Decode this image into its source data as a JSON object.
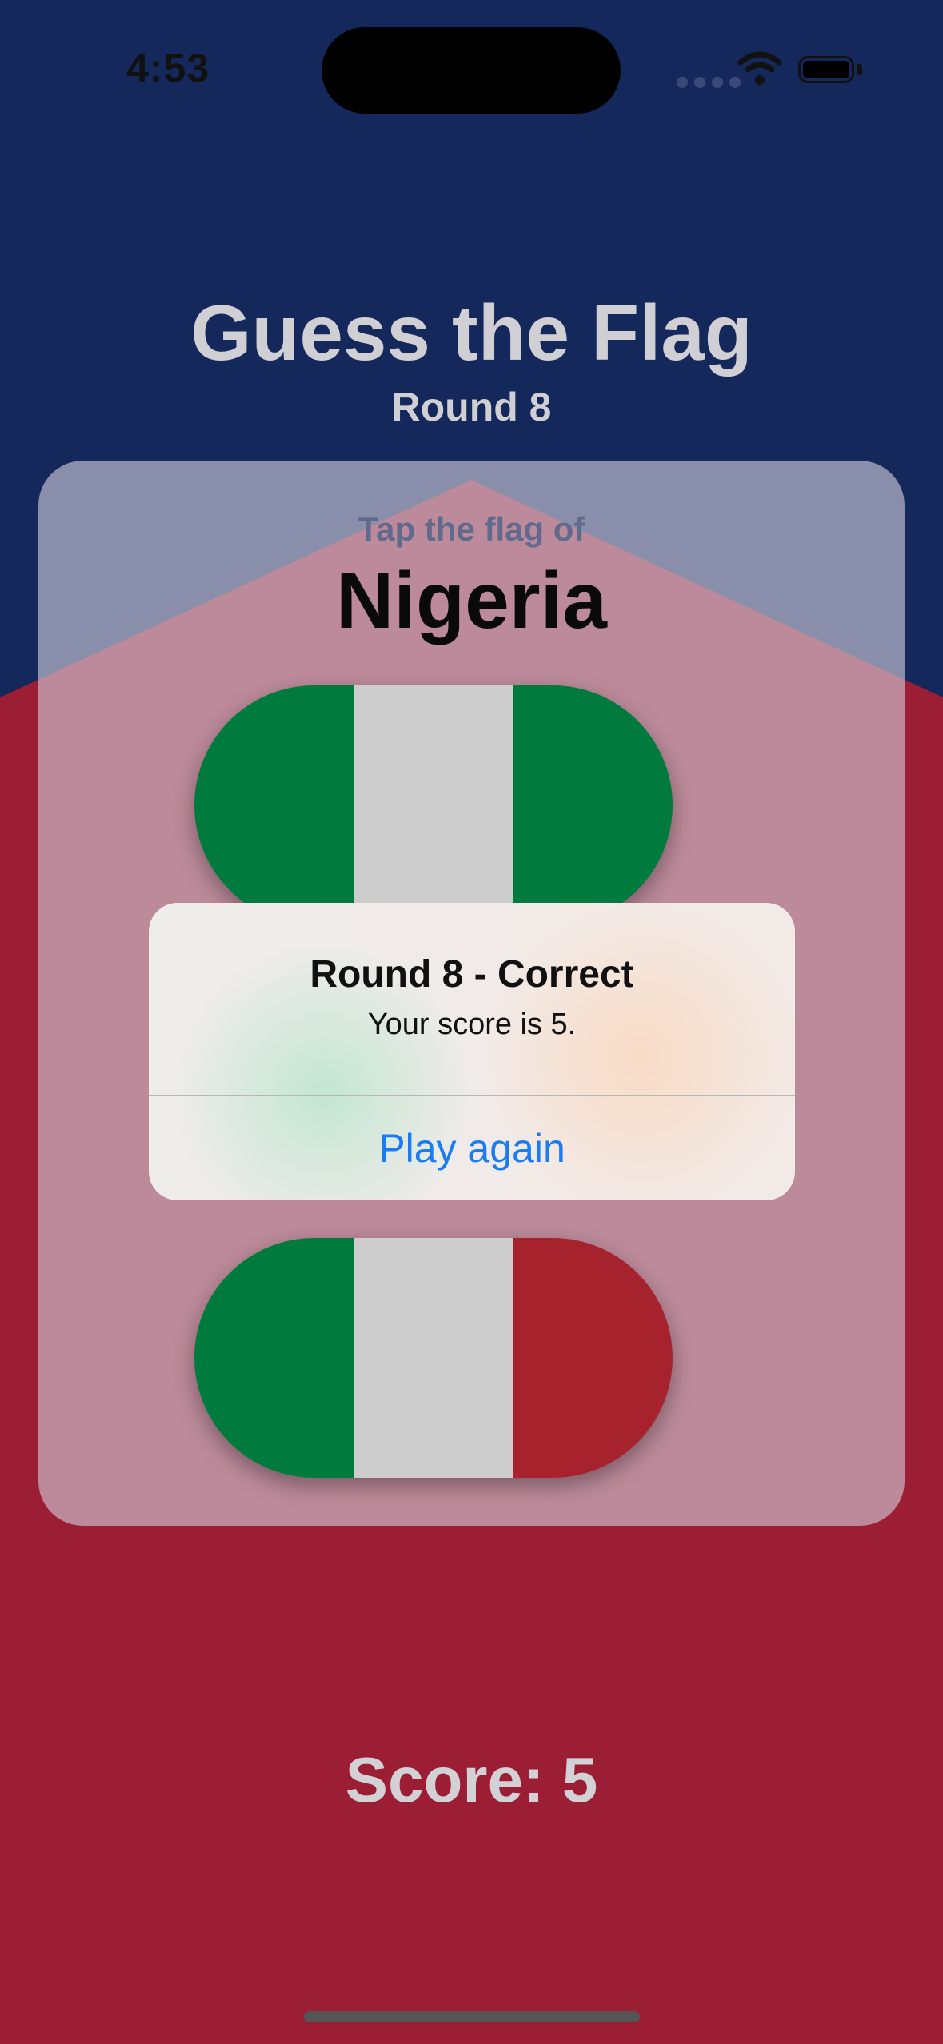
{
  "status_bar": {
    "time": "4:53"
  },
  "header": {
    "title": "Guess the Flag",
    "round": "Round 8"
  },
  "card": {
    "prompt": "Tap the flag of",
    "country": "Nigeria",
    "flags": [
      {
        "name": "Nigeria",
        "colors": [
          "#007a3d",
          "#cccccc",
          "#007a3d"
        ]
      },
      {
        "name": "Italy",
        "colors": [
          "#007a3d",
          "#cccccc",
          "#a6222d"
        ]
      }
    ]
  },
  "alert": {
    "title": "Round 8 - Correct",
    "message": "Your score is 5.",
    "button": "Play again"
  },
  "footer": {
    "score": "Score: 5"
  },
  "colors": {
    "navy": "#15285c",
    "crimson": "#9c1e34",
    "accent": "#1a7cf0"
  }
}
